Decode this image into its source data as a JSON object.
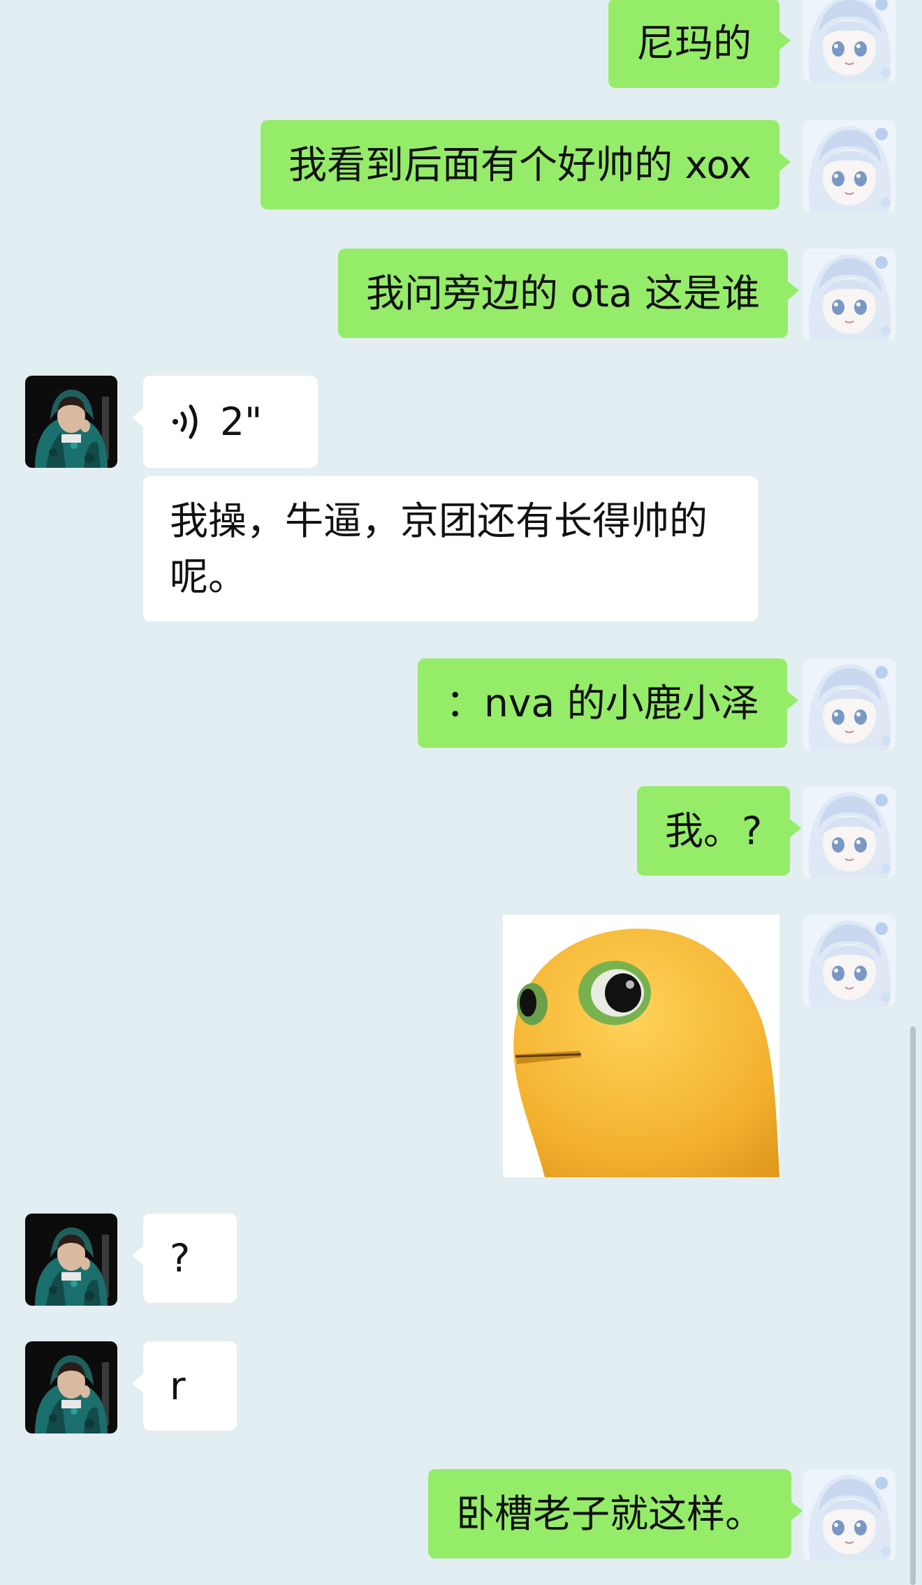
{
  "messages": [
    {
      "from": "me",
      "type": "text",
      "text": "尼玛的"
    },
    {
      "from": "me",
      "type": "text",
      "text": "我看到后面有个好帅的 xox"
    },
    {
      "from": "me",
      "type": "text",
      "text": "我问旁边的 ota 这是谁"
    },
    {
      "from": "them",
      "type": "voice",
      "duration": "2\""
    },
    {
      "from": "them",
      "type": "text",
      "text": "我操，牛逼，京团还有长得帅的呢。"
    },
    {
      "from": "me",
      "type": "text",
      "text": "：nva 的小鹿小泽"
    },
    {
      "from": "me",
      "type": "text",
      "text": "我。?"
    },
    {
      "from": "me",
      "type": "sticker",
      "icon": "yellow-bird-sticker"
    },
    {
      "from": "them",
      "type": "text",
      "text": "?"
    },
    {
      "from": "them",
      "type": "text",
      "text": "r"
    },
    {
      "from": "me",
      "type": "text",
      "text": "卧槽老子就这样。"
    }
  ],
  "colors": {
    "background": "#e2eef1",
    "self_bubble": "#95ec69",
    "other_bubble": "#ffffff"
  }
}
